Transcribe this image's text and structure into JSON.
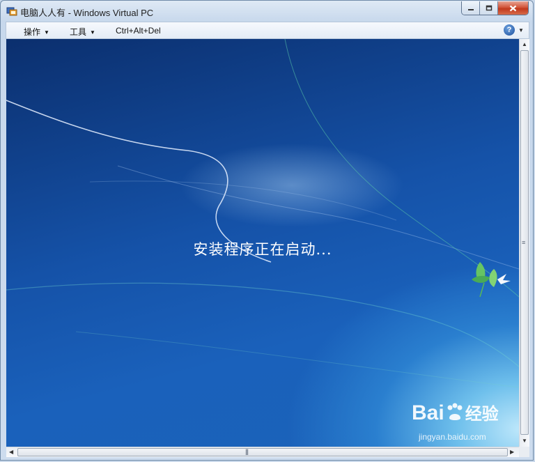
{
  "window": {
    "title": "电脑人人有 - Windows Virtual PC",
    "app_icon": "virtual-pc-icon"
  },
  "caption_buttons": [
    "minimize-icon",
    "restore-icon",
    "close-icon"
  ],
  "menubar": {
    "items": [
      {
        "label": "操作",
        "has_dropdown": true
      },
      {
        "label": "工具",
        "has_dropdown": true
      },
      {
        "label": "Ctrl+Alt+Del",
        "has_dropdown": false
      }
    ],
    "help_label": "?"
  },
  "vm_screen": {
    "status_text": "安装程序正在启动...",
    "background": "windows-7-setup-wallpaper",
    "watermark": {
      "logo_text": "Bai",
      "logo_text2": "经验",
      "sub_text": "jingyan.baidu.com"
    }
  },
  "colors": {
    "accent_blue": "#1552a8",
    "close_red": "#c1391c"
  }
}
